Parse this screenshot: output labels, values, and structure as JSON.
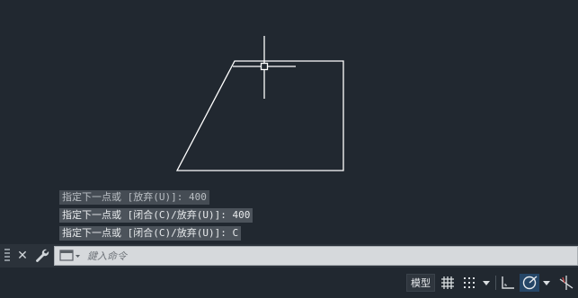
{
  "history": [
    {
      "text": "指定下一点或 [放弃(U)]: 400",
      "style": "old"
    },
    {
      "text": "指定下一点或 [闭合(C)/放弃(U)]: 400",
      "style": "current"
    },
    {
      "text": "指定下一点或 [闭合(C)/放弃(U)]: C",
      "style": "current"
    }
  ],
  "command_line": {
    "placeholder": "鍵入命令",
    "close_glyph": "✕"
  },
  "status_bar": {
    "model_label": "模型"
  },
  "icons": {
    "close": "close-icon",
    "customize": "wrench-icon",
    "recent_commands": "recent-commands-icon",
    "grid": "grid-icon",
    "snap": "snap-mode-icon",
    "ortho": "ortho-mode-icon",
    "polar": "polar-tracking-icon",
    "isodraft": "isometric-drafting-icon"
  },
  "colors": {
    "background": "#212830",
    "geometry": "#ffffff",
    "accent": "#2f7fcf"
  }
}
